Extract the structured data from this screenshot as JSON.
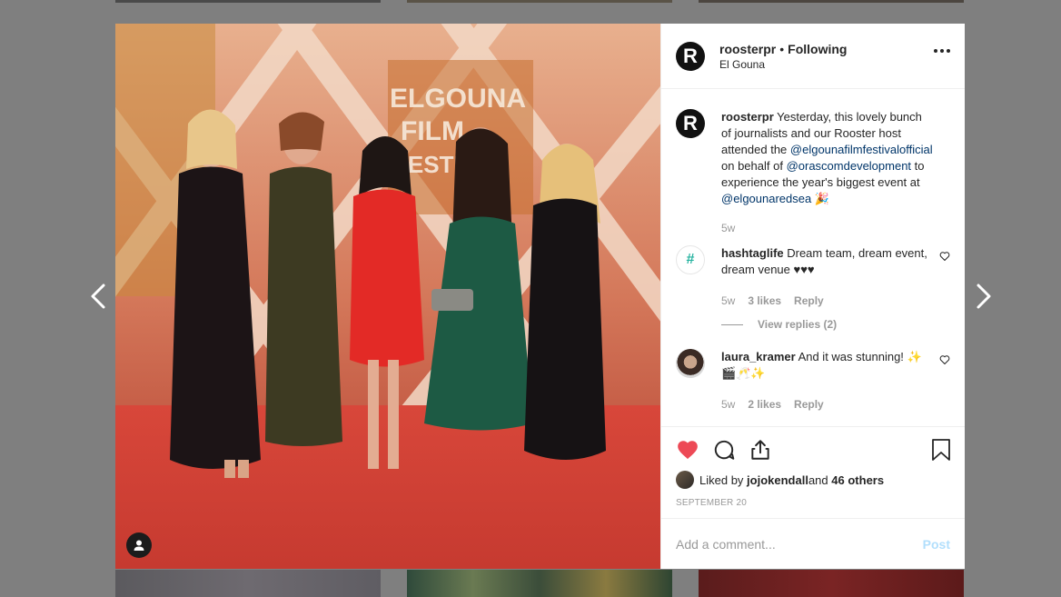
{
  "post": {
    "username": "roosterpr",
    "separator": "•",
    "follow_status": "Following",
    "location": "El Gouna",
    "avatar_letter": "R",
    "photo_sign": {
      "line1": "ELGOUNA",
      "line2": "FILM",
      "line3": "FESTIVAL"
    }
  },
  "caption": {
    "username": "roosterpr",
    "text_1": " Yesterday, this lovely bunch of journalists and our Rooster host attended the ",
    "mention_1": "@elgounafilmfestivalofficial",
    "text_2": " on behalf of ",
    "mention_2": "@orascomdevelopment",
    "text_3": " to experience the year's biggest event at ",
    "mention_3": "@elgounaredsea",
    "emoji": " 🎉",
    "time": "5w"
  },
  "comments": [
    {
      "username": "hashtaglife",
      "text": " Dream team, dream event, dream venue ♥♥♥",
      "time": "5w",
      "likes": "3 likes",
      "reply_label": "Reply",
      "view_replies": "View replies (2)",
      "avatar_glyph": "#"
    },
    {
      "username": "laura_kramer",
      "text": " And it was stunning! ✨🎬🥂✨",
      "time": "5w",
      "likes": "2 likes",
      "reply_label": "Reply"
    }
  ],
  "likes": {
    "prefix": "Liked by ",
    "user": "jojokendall",
    "middle": " and ",
    "others": "46 others"
  },
  "date": "SEPTEMBER 20",
  "add_comment": {
    "placeholder": "Add a comment...",
    "post_label": "Post"
  },
  "colors": {
    "heart_liked": "#ed4956",
    "mention": "#003569",
    "post_disabled": "#b2dffc"
  }
}
